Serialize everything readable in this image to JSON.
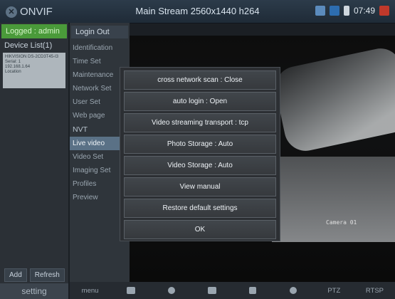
{
  "app": {
    "name": "ONVIF"
  },
  "header": {
    "title": "Main Stream 2560x1440 h264",
    "time": "07:49"
  },
  "left_panel": {
    "logged": "Logged : admin",
    "device_list": "Device List(1)",
    "device_card": {
      "name": "HIKVISION DS-2CD3T45-I3",
      "serial": "Serial: 1",
      "ip": "192.168.1.64",
      "location": "Location"
    },
    "add_label": "Add",
    "refresh_label": "Refresh",
    "setting_label": "setting"
  },
  "menu": {
    "login_out": "Login Out",
    "items": [
      "Identification",
      "Time Set",
      "Maintenance",
      "Network Set",
      "User Set",
      "Web page",
      "NVT",
      "Live video",
      "Video Set",
      "Imaging Set",
      "Profiles",
      "Preview"
    ]
  },
  "video": {
    "camera_label": "Camera 01"
  },
  "dialog": {
    "options": [
      "cross network scan : Close",
      "auto login   : Open",
      "Video streaming transport : tcp",
      "Photo Storage : Auto",
      "Video Storage : Auto",
      "View manual",
      "Restore default settings",
      "OK"
    ]
  },
  "bottom_bar": {
    "menu_label": "menu",
    "ptz_label": "PTZ",
    "rtsp_label": "RTSP"
  }
}
